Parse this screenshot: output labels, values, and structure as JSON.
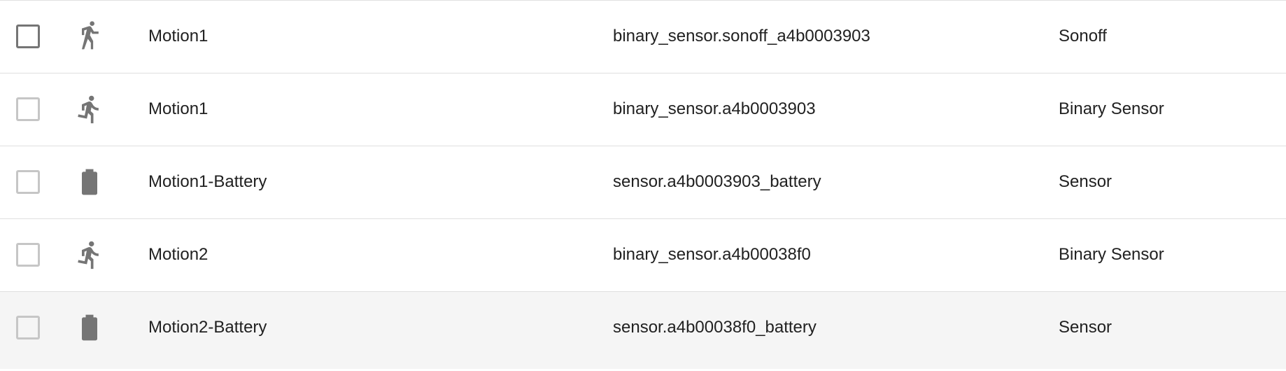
{
  "table": {
    "rows": [
      {
        "name": "Motion1",
        "entity_id": "binary_sensor.sonoff_a4b0003903",
        "integration": "Sonoff",
        "icon": "walk-icon"
      },
      {
        "name": "Motion1",
        "entity_id": "binary_sensor.a4b0003903",
        "integration": "Binary Sensor",
        "icon": "run-icon"
      },
      {
        "name": "Motion1-Battery",
        "entity_id": "sensor.a4b0003903_battery",
        "integration": "Sensor",
        "icon": "battery-icon"
      },
      {
        "name": "Motion2",
        "entity_id": "binary_sensor.a4b00038f0",
        "integration": "Binary Sensor",
        "icon": "run-icon"
      },
      {
        "name": "Motion2-Battery",
        "entity_id": "sensor.a4b00038f0_battery",
        "integration": "Sensor",
        "icon": "battery-icon"
      }
    ]
  },
  "colors": {
    "icon": "#757575",
    "text": "#212121",
    "divider": "#e0e0e0",
    "hover_row": "#f5f5f5"
  }
}
